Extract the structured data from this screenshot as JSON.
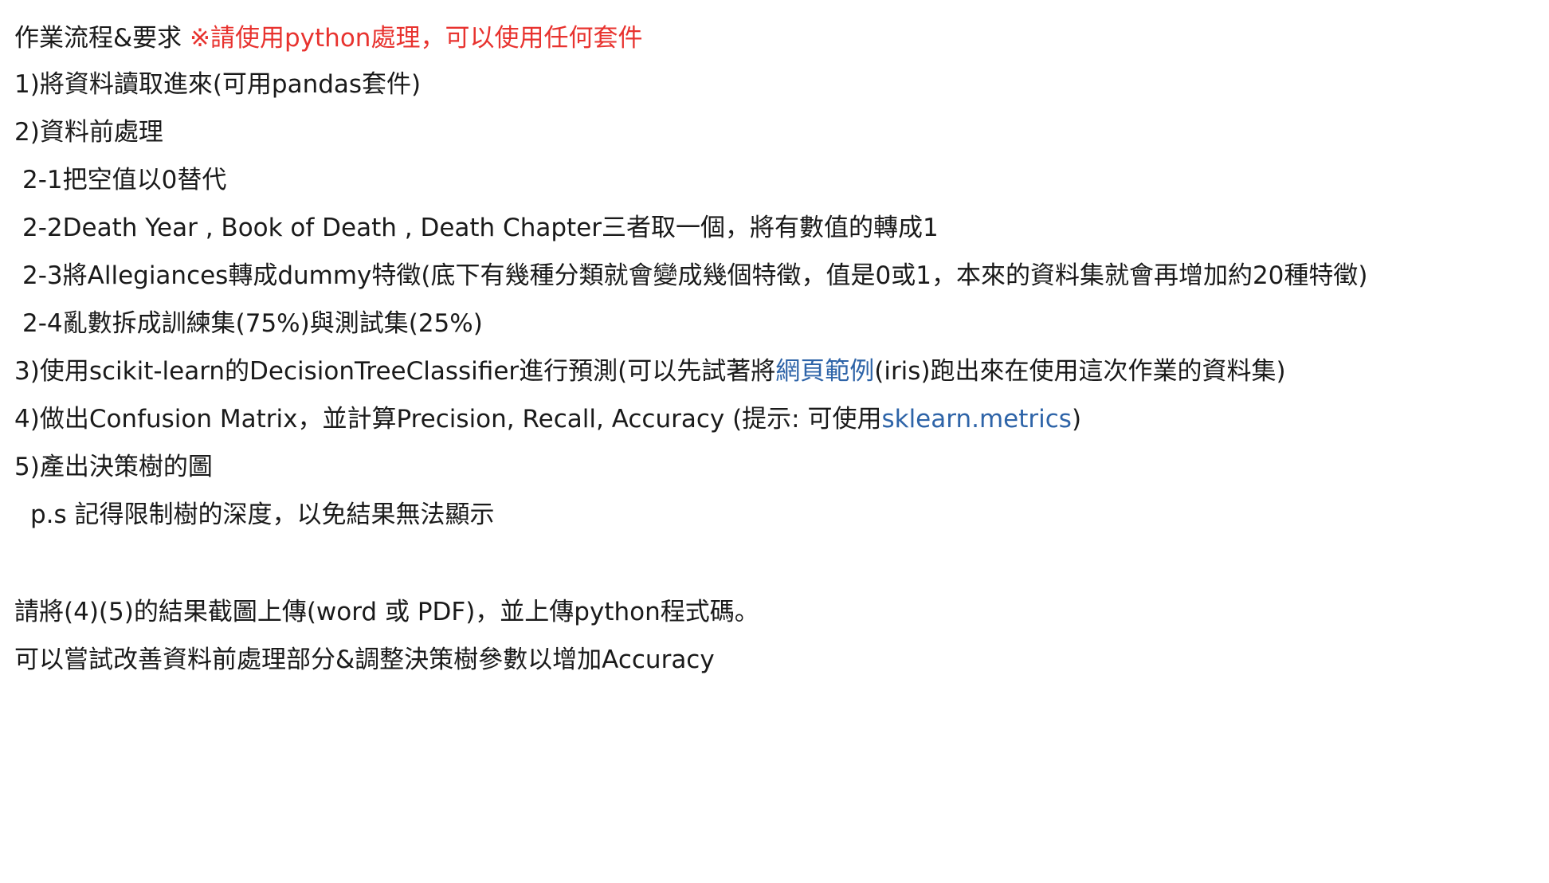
{
  "title": {
    "text": "作業流程&要求 ",
    "note": "※請使用python處理，可以使用任何套件"
  },
  "step1": "1)將資料讀取進來(可用pandas套件)",
  "step2": "2)資料前處理",
  "step2_1": "2-1把空值以0替代",
  "step2_2": "2-2Death Year , Book of Death , Death Chapter三者取一個，將有數值的轉成1",
  "step2_3": "2-3將Allegiances轉成dummy特徵(底下有幾種分類就會變成幾個特徵，值是0或1，本來的資料集就會再增加約20種特徵)",
  "step2_4": "2-4亂數拆成訓練集(75%)與測試集(25%)",
  "step3": {
    "pre": "3)使用scikit-learn的DecisionTreeClassifier進行預測(可以先試著將",
    "link": "網頁範例",
    "post": "(iris)跑出來在使用這次作業的資料集)"
  },
  "step4": {
    "pre": "4)做出Confusion Matrix，並計算Precision, Recall, Accuracy (提示: 可使用",
    "link": "sklearn.metrics",
    "post": ")"
  },
  "step5": "5)產出決策樹的圖",
  "ps": "p.s 記得限制樹的深度，以免結果無法顯示",
  "upload": "請將(4)(5)的結果截圖上傳(word 或 PDF)，並上傳python程式碼。",
  "improve": "可以嘗試改善資料前處理部分&調整決策樹參數以增加Accuracy",
  "colors": {
    "note_red": "#e8332f",
    "link_blue": "#2e64a8",
    "text": "#1a1a1a"
  }
}
